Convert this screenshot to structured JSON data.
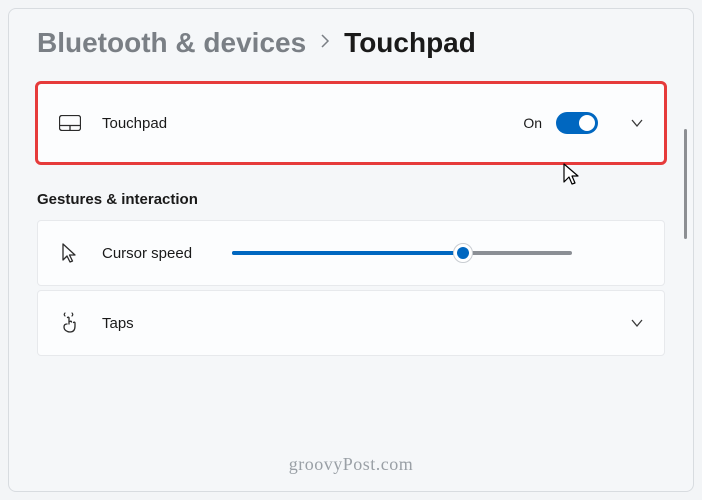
{
  "breadcrumb": {
    "parent": "Bluetooth & devices",
    "current": "Touchpad"
  },
  "touchpad_card": {
    "label": "Touchpad",
    "state": "On"
  },
  "section": {
    "heading": "Gestures & interaction"
  },
  "cursor_speed": {
    "label": "Cursor speed",
    "value_percent": 68
  },
  "taps": {
    "label": "Taps"
  },
  "watermark": "groovyPost.com"
}
